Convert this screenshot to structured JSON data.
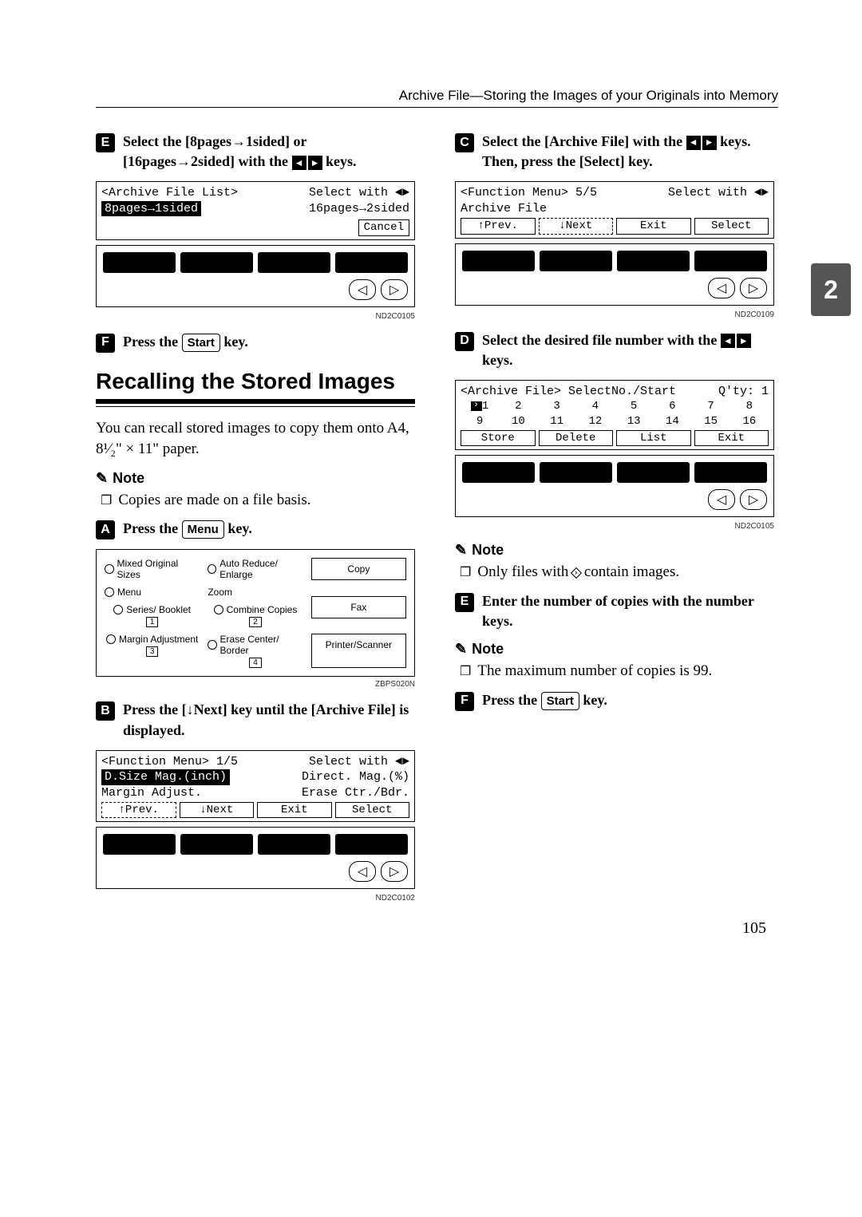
{
  "header": "Archive File—Storing the Images of your Originals into Memory",
  "side_tab": "2",
  "page_number": "105",
  "left": {
    "step5": {
      "text_a": "Select the ",
      "opt1": "[8pages→1sided]",
      "mid": " or ",
      "opt2": "[16pages→2sided]",
      "text_b": " with the ",
      "text_c": " keys."
    },
    "lcd1": {
      "title": "<Archive File List>",
      "hint": "Select with",
      "opt_sel": "8pages→1sided",
      "opt_other": "16pages→2sided",
      "cancel": "Cancel"
    },
    "fig1": "ND2C0105",
    "step6": {
      "a": "Press the ",
      "key": "Start",
      "b": " key."
    },
    "section": "Recalling the Stored Images",
    "intro": "You can recall stored images to copy them onto A4, 8¹⁄₂\" × 11\" paper.",
    "note_label": "Note",
    "note1": "Copies are made on a file basis.",
    "stepA": {
      "a": "Press the ",
      "key": "Menu",
      "b": " key."
    },
    "menu": {
      "mixed": "Mixed Original Sizes",
      "auto": "Auto Reduce/ Enlarge",
      "menu": "Menu",
      "zoom": "Zoom",
      "series": "Series/ Booklet",
      "combine": "Combine Copies",
      "margin": "Margin Adjustment",
      "erase": "Erase Center/ Border",
      "copy": "Copy",
      "fax": "Fax",
      "ps": "Printer/Scanner",
      "t1": "1",
      "t2": "2",
      "t3": "3",
      "t4": "4"
    },
    "fig_menu": "ZBPS020N",
    "stepB": {
      "a": "Press the ",
      "key": "[↓Next]",
      "b": " key until the ",
      "c": "[Archive File]",
      "d": " is displayed."
    },
    "lcd2": {
      "title": "<Function Menu> 1/5",
      "hint": "Select with",
      "r1a": "D.Size Mag.(inch)",
      "r1b": "Direct. Mag.(%)",
      "r2a": "Margin Adjust.",
      "r2b": "Erase Ctr./Bdr.",
      "prev": "↑Prev.",
      "next": "↓Next",
      "exit": "Exit",
      "select": "Select"
    },
    "fig2": "ND2C0102"
  },
  "right": {
    "step3": {
      "a": "Select the ",
      "b": "[Archive File]",
      "c": " with the ",
      "d": " keys. Then, press the ",
      "e": "[Select]",
      "f": " key."
    },
    "lcd3": {
      "title": "<Function Menu> 5/5",
      "hint": "Select with",
      "item": "Archive File",
      "prev": "↑Prev.",
      "next": "↓Next",
      "exit": "Exit",
      "select": "Select"
    },
    "fig3": "ND2C0109",
    "step4": {
      "a": "Select the desired file number with the ",
      "b": " keys."
    },
    "lcd4": {
      "title": "<Archive File> SelectNo./Start",
      "qty": "Q'ty:  1",
      "row1": [
        "1",
        "2",
        "3",
        "4",
        "5",
        "6",
        "7",
        "8"
      ],
      "row2": [
        "9",
        "10",
        "11",
        "12",
        "13",
        "14",
        "15",
        "16"
      ],
      "store": "Store",
      "delete": "Delete",
      "list": "List",
      "exit": "Exit"
    },
    "fig4": "ND2C0105",
    "note_label": "Note",
    "note_r1a": "Only files with ",
    "note_r1b": " contain images.",
    "step5r": {
      "a": "Enter the number of copies with the number keys."
    },
    "note_r2": "The maximum number of copies is 99.",
    "step6r": {
      "a": "Press the ",
      "key": "Start",
      "b": " key."
    }
  }
}
